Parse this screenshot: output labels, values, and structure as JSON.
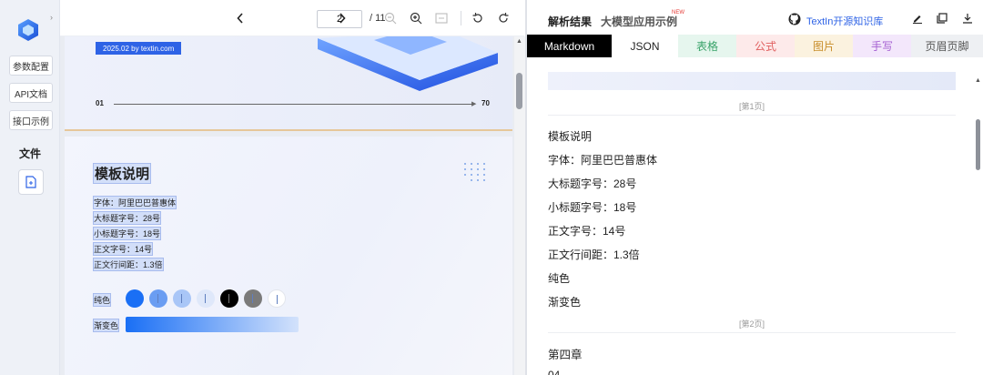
{
  "sidebar": {
    "buttons": [
      "参数配置",
      "API文档",
      "接口示例"
    ],
    "files_label": "文件"
  },
  "toolbar": {
    "current_page": "2",
    "total_pages": "/ 11"
  },
  "document": {
    "page1": {
      "tag_text": "2025.02 by textin.com",
      "axis_start": "01",
      "axis_end": "70"
    },
    "page2": {
      "title": "模板说明",
      "lines": [
        "字体：阿里巴巴普惠体",
        "大标题字号：28号",
        "小标题字号：18号",
        "正文字号：14号",
        "正文行间距：1.3倍"
      ],
      "solid_label": "纯色",
      "gradient_label": "渐变色",
      "swatches": [
        "#1a6ff5",
        "#6a9df2",
        "#a9c6f7",
        "#dfe8fa",
        "#000000",
        "#7a7a7a",
        "#ffffff"
      ]
    }
  },
  "result_panel": {
    "title": "解析结果",
    "examples_link": "大模型应用示例",
    "new_badge": "NEW",
    "repo_link": "TextIn开源知识库",
    "tabs": [
      {
        "label": "Markdown",
        "bg": "#000000",
        "color": "#ffffff"
      },
      {
        "label": "JSON",
        "bg": "#ffffff",
        "color": "#222222"
      },
      {
        "label": "表格",
        "bg": "#e6f6ee",
        "color": "#3aa36a"
      },
      {
        "label": "公式",
        "bg": "#fdeaea",
        "color": "#e06060"
      },
      {
        "label": "图片",
        "bg": "#fbf2df",
        "color": "#c98e2b"
      },
      {
        "label": "手写",
        "bg": "#f3e7fb",
        "color": "#a560d2"
      },
      {
        "label": "页眉页脚",
        "bg": "#eef0f3",
        "color": "#555555"
      }
    ],
    "page1_marker": "[第1页]",
    "content": [
      "模板说明",
      "字体：阿里巴巴普惠体",
      "大标题字号：28号",
      "小标题字号：18号",
      "正文字号：14号",
      "正文行间距：1.3倍",
      "纯色",
      "渐变色"
    ],
    "page2_marker": "[第2页]",
    "page2_content": [
      "第四章",
      "04"
    ]
  },
  "colors": {
    "accent": "#2e63e6",
    "brand_blue": "#1a6ff5",
    "link": "#2e63e6"
  }
}
